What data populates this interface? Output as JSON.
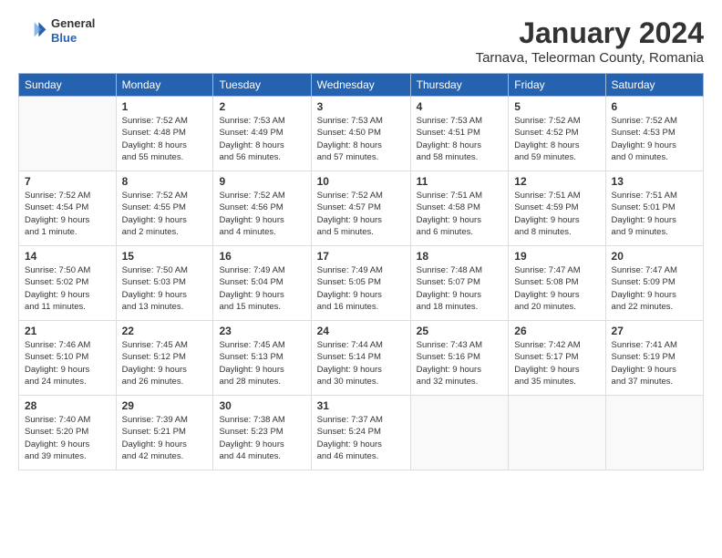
{
  "header": {
    "logo_general": "General",
    "logo_blue": "Blue",
    "month_title": "January 2024",
    "location": "Tarnava, Teleorman County, Romania"
  },
  "weekdays": [
    "Sunday",
    "Monday",
    "Tuesday",
    "Wednesday",
    "Thursday",
    "Friday",
    "Saturday"
  ],
  "weeks": [
    [
      {
        "day": "",
        "info": ""
      },
      {
        "day": "1",
        "info": "Sunrise: 7:52 AM\nSunset: 4:48 PM\nDaylight: 8 hours\nand 55 minutes."
      },
      {
        "day": "2",
        "info": "Sunrise: 7:53 AM\nSunset: 4:49 PM\nDaylight: 8 hours\nand 56 minutes."
      },
      {
        "day": "3",
        "info": "Sunrise: 7:53 AM\nSunset: 4:50 PM\nDaylight: 8 hours\nand 57 minutes."
      },
      {
        "day": "4",
        "info": "Sunrise: 7:53 AM\nSunset: 4:51 PM\nDaylight: 8 hours\nand 58 minutes."
      },
      {
        "day": "5",
        "info": "Sunrise: 7:52 AM\nSunset: 4:52 PM\nDaylight: 8 hours\nand 59 minutes."
      },
      {
        "day": "6",
        "info": "Sunrise: 7:52 AM\nSunset: 4:53 PM\nDaylight: 9 hours\nand 0 minutes."
      }
    ],
    [
      {
        "day": "7",
        "info": "Sunrise: 7:52 AM\nSunset: 4:54 PM\nDaylight: 9 hours\nand 1 minute."
      },
      {
        "day": "8",
        "info": "Sunrise: 7:52 AM\nSunset: 4:55 PM\nDaylight: 9 hours\nand 2 minutes."
      },
      {
        "day": "9",
        "info": "Sunrise: 7:52 AM\nSunset: 4:56 PM\nDaylight: 9 hours\nand 4 minutes."
      },
      {
        "day": "10",
        "info": "Sunrise: 7:52 AM\nSunset: 4:57 PM\nDaylight: 9 hours\nand 5 minutes."
      },
      {
        "day": "11",
        "info": "Sunrise: 7:51 AM\nSunset: 4:58 PM\nDaylight: 9 hours\nand 6 minutes."
      },
      {
        "day": "12",
        "info": "Sunrise: 7:51 AM\nSunset: 4:59 PM\nDaylight: 9 hours\nand 8 minutes."
      },
      {
        "day": "13",
        "info": "Sunrise: 7:51 AM\nSunset: 5:01 PM\nDaylight: 9 hours\nand 9 minutes."
      }
    ],
    [
      {
        "day": "14",
        "info": "Sunrise: 7:50 AM\nSunset: 5:02 PM\nDaylight: 9 hours\nand 11 minutes."
      },
      {
        "day": "15",
        "info": "Sunrise: 7:50 AM\nSunset: 5:03 PM\nDaylight: 9 hours\nand 13 minutes."
      },
      {
        "day": "16",
        "info": "Sunrise: 7:49 AM\nSunset: 5:04 PM\nDaylight: 9 hours\nand 15 minutes."
      },
      {
        "day": "17",
        "info": "Sunrise: 7:49 AM\nSunset: 5:05 PM\nDaylight: 9 hours\nand 16 minutes."
      },
      {
        "day": "18",
        "info": "Sunrise: 7:48 AM\nSunset: 5:07 PM\nDaylight: 9 hours\nand 18 minutes."
      },
      {
        "day": "19",
        "info": "Sunrise: 7:47 AM\nSunset: 5:08 PM\nDaylight: 9 hours\nand 20 minutes."
      },
      {
        "day": "20",
        "info": "Sunrise: 7:47 AM\nSunset: 5:09 PM\nDaylight: 9 hours\nand 22 minutes."
      }
    ],
    [
      {
        "day": "21",
        "info": "Sunrise: 7:46 AM\nSunset: 5:10 PM\nDaylight: 9 hours\nand 24 minutes."
      },
      {
        "day": "22",
        "info": "Sunrise: 7:45 AM\nSunset: 5:12 PM\nDaylight: 9 hours\nand 26 minutes."
      },
      {
        "day": "23",
        "info": "Sunrise: 7:45 AM\nSunset: 5:13 PM\nDaylight: 9 hours\nand 28 minutes."
      },
      {
        "day": "24",
        "info": "Sunrise: 7:44 AM\nSunset: 5:14 PM\nDaylight: 9 hours\nand 30 minutes."
      },
      {
        "day": "25",
        "info": "Sunrise: 7:43 AM\nSunset: 5:16 PM\nDaylight: 9 hours\nand 32 minutes."
      },
      {
        "day": "26",
        "info": "Sunrise: 7:42 AM\nSunset: 5:17 PM\nDaylight: 9 hours\nand 35 minutes."
      },
      {
        "day": "27",
        "info": "Sunrise: 7:41 AM\nSunset: 5:19 PM\nDaylight: 9 hours\nand 37 minutes."
      }
    ],
    [
      {
        "day": "28",
        "info": "Sunrise: 7:40 AM\nSunset: 5:20 PM\nDaylight: 9 hours\nand 39 minutes."
      },
      {
        "day": "29",
        "info": "Sunrise: 7:39 AM\nSunset: 5:21 PM\nDaylight: 9 hours\nand 42 minutes."
      },
      {
        "day": "30",
        "info": "Sunrise: 7:38 AM\nSunset: 5:23 PM\nDaylight: 9 hours\nand 44 minutes."
      },
      {
        "day": "31",
        "info": "Sunrise: 7:37 AM\nSunset: 5:24 PM\nDaylight: 9 hours\nand 46 minutes."
      },
      {
        "day": "",
        "info": ""
      },
      {
        "day": "",
        "info": ""
      },
      {
        "day": "",
        "info": ""
      }
    ]
  ]
}
